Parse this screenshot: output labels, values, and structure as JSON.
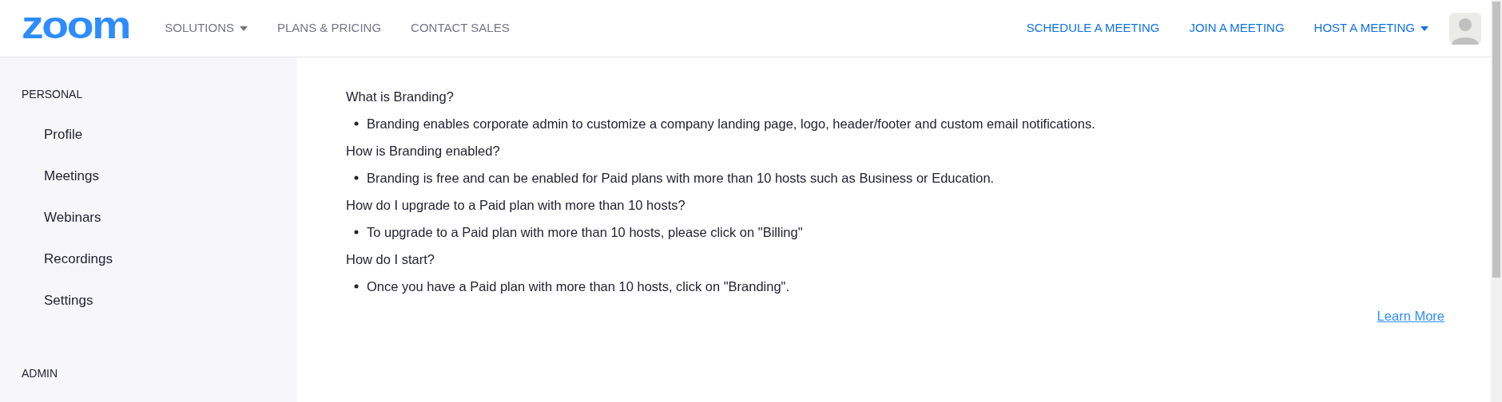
{
  "header": {
    "logo": "zoom",
    "nav_left": [
      {
        "label": "SOLUTIONS",
        "dropdown": true
      },
      {
        "label": "PLANS & PRICING",
        "dropdown": false
      },
      {
        "label": "CONTACT SALES",
        "dropdown": false
      }
    ],
    "nav_right": [
      {
        "label": "SCHEDULE A MEETING",
        "dropdown": false
      },
      {
        "label": "JOIN A MEETING",
        "dropdown": false
      },
      {
        "label": "HOST A MEETING",
        "dropdown": true
      }
    ]
  },
  "sidebar": {
    "sections": [
      {
        "heading": "PERSONAL",
        "items": [
          "Profile",
          "Meetings",
          "Webinars",
          "Recordings",
          "Settings"
        ]
      },
      {
        "heading": "ADMIN"
      }
    ]
  },
  "content": {
    "faq": [
      {
        "question": "What is Branding?",
        "answer": "Branding enables corporate admin to customize a company landing page, logo, header/footer and custom email notifications."
      },
      {
        "question": "How is Branding enabled?",
        "answer": "Branding is free and can be enabled for Paid plans with more than 10 hosts such as Business or Education."
      },
      {
        "question": "How do I upgrade to a Paid plan with more than 10 hosts?",
        "answer": "To upgrade to a Paid plan with more than 10 hosts, please click on \"Billing\""
      },
      {
        "question": "How do I start?",
        "answer": "Once you have a Paid plan with more than 10 hosts, click on \"Branding\"."
      }
    ],
    "link": "Learn More"
  }
}
